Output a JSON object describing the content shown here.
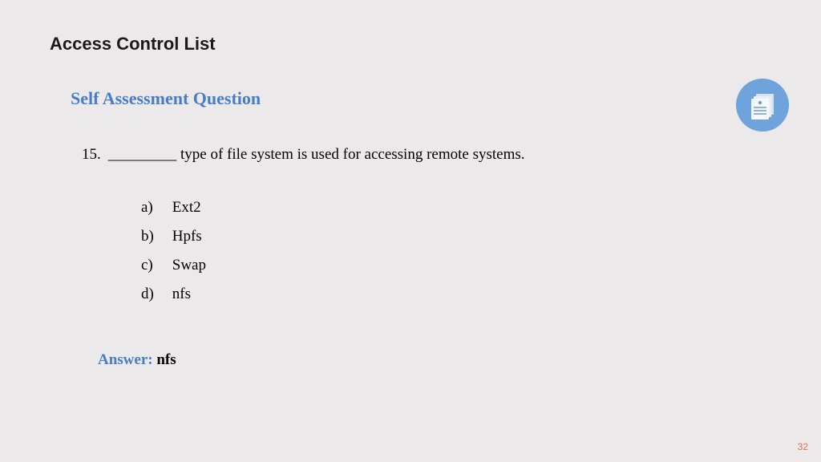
{
  "slide": {
    "title": "Access Control List",
    "subtitle": "Self Assessment Question"
  },
  "question": {
    "number": "15.",
    "text": "_________ type of file system is used for accessing remote systems."
  },
  "options": [
    {
      "letter": "a)",
      "text": "Ext2"
    },
    {
      "letter": "b)",
      "text": "Hpfs"
    },
    {
      "letter": "c)",
      "text": "Swap"
    },
    {
      "letter": "d)",
      "text": "nfs"
    }
  ],
  "answer": {
    "label": "Answer: ",
    "value": "nfs"
  },
  "page_number": "32",
  "icon_name": "document-stack-icon"
}
